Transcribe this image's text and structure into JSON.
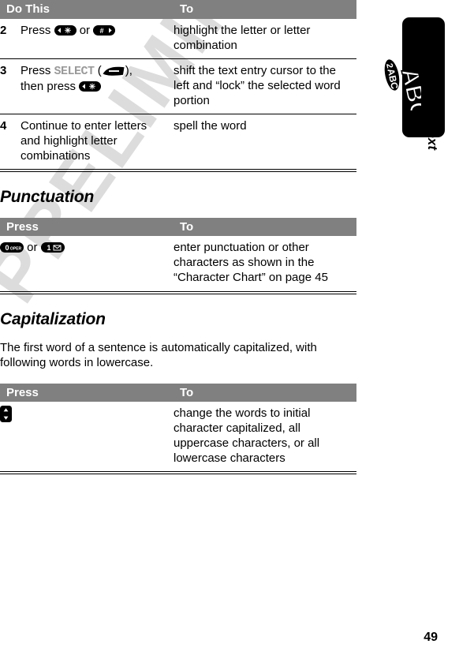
{
  "document": {
    "chapter_title": "Entering Text",
    "page_number": "49",
    "watermark": "PRELIMINARY"
  },
  "procedure_table": {
    "headers": {
      "col1": "Do This",
      "col2": "To"
    },
    "rows": [
      {
        "num": "2",
        "do_this_prefix": "Press",
        "do_this_mid": "or",
        "do_this_suffix": "",
        "keys": [
          "star-left-key",
          "pound-right-key"
        ],
        "to": "highlight the letter or letter combination"
      },
      {
        "num": "3",
        "do_this_prefix": "Press",
        "softkey_label": "SELECT",
        "do_this_mid": "then press",
        "keys": [
          "softkey-arrow",
          "star-left-key"
        ],
        "to": "shift the text entry cursor to the left and “lock” the selected word portion"
      },
      {
        "num": "4",
        "do_this_plain": "Continue to enter letters and highlight letter combinations",
        "to": "spell the word"
      }
    ]
  },
  "punctuation": {
    "heading": "Punctuation",
    "table": {
      "headers": {
        "col1": "Press",
        "col2": "To"
      },
      "row": {
        "keys": [
          "zero-oper-key",
          "one-voicemail-key"
        ],
        "conjunction": "or",
        "to": "enter punctuation or other characters as shown in the “Character Chart” on page 45"
      }
    }
  },
  "capitalization": {
    "heading": "Capitalization",
    "body": "The first word of a sentence is automatically capitalized, with following words in lowercase.",
    "table": {
      "headers": {
        "col1": "Press",
        "col2": "To"
      },
      "row": {
        "key": "nav-up-down-key",
        "to": "change the words to initial character capitalized, all uppercase characters, or all lowercase characters"
      }
    }
  },
  "colors": {
    "header_bg": "#808080",
    "header_text": "#ffffff",
    "rule": "#000000",
    "softkey_label": "#9a9a9a",
    "watermark": "#dcdcdc"
  }
}
